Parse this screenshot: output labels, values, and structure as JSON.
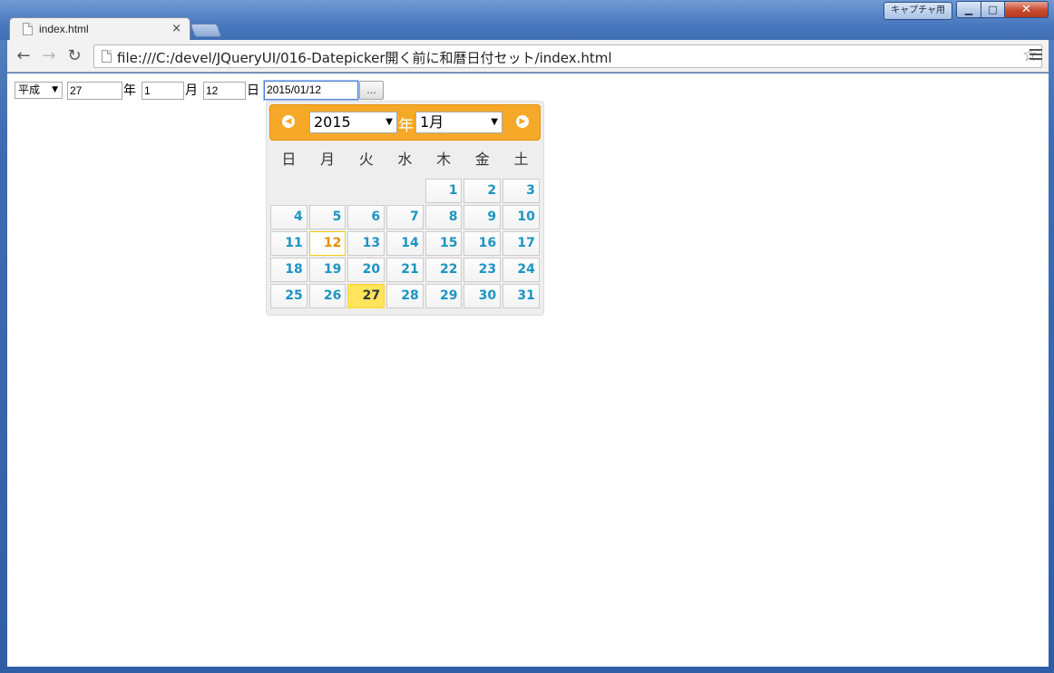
{
  "window": {
    "caption_label": "キャプチャ用",
    "minimize_glyph": "▁",
    "maximize_glyph": "□",
    "close_glyph": "✕"
  },
  "tab": {
    "title": "index.html",
    "close_glyph": "×"
  },
  "toolbar": {
    "back_glyph": "←",
    "forward_glyph": "→",
    "reload_glyph": "↻",
    "url": "file:///C:/devel/JQueryUI/016-Datepicker開く前に和暦日付セット/index.html",
    "star_glyph": "☆"
  },
  "form": {
    "era": "平成",
    "year_value": "27",
    "year_unit": "年",
    "month_value": "1",
    "month_unit": "月",
    "day_value": "12",
    "day_unit": "日",
    "date_value": "2015/01/12",
    "trigger_label": "..."
  },
  "datepicker": {
    "prev_glyph": "◀",
    "next_glyph": "▶",
    "year": "2015",
    "year_suffix": "年",
    "month": "1月",
    "weekdays": [
      "日",
      "月",
      "火",
      "水",
      "木",
      "金",
      "土"
    ],
    "weeks": [
      [
        "",
        "",
        "",
        "",
        "1",
        "2",
        "3"
      ],
      [
        "4",
        "5",
        "6",
        "7",
        "8",
        "9",
        "10"
      ],
      [
        "11",
        "12",
        "13",
        "14",
        "15",
        "16",
        "17"
      ],
      [
        "18",
        "19",
        "20",
        "21",
        "22",
        "23",
        "24"
      ],
      [
        "25",
        "26",
        "27",
        "28",
        "29",
        "30",
        "31"
      ]
    ],
    "selected_day": "12",
    "today_day": "27"
  }
}
